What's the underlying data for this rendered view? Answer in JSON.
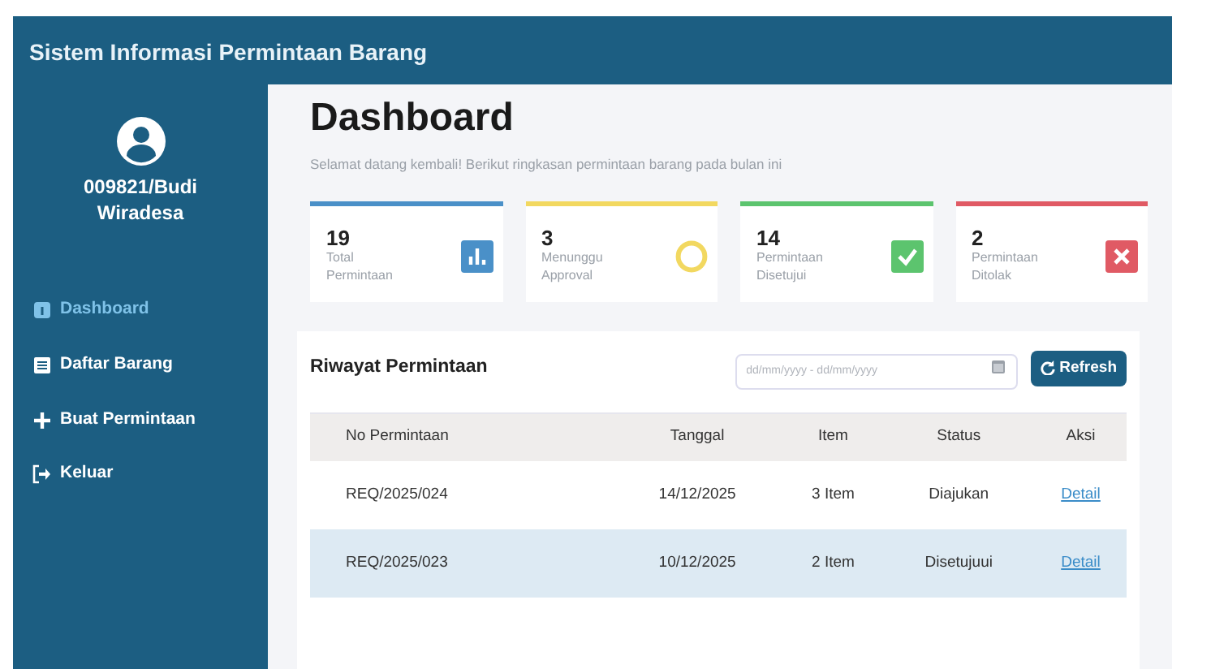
{
  "app_title": "Sistem Informasi Permintaan Barang",
  "user": {
    "name": "009821/Budi Wiradesa"
  },
  "sidebar": {
    "items": [
      {
        "label": "Dashboard",
        "kind": "gauge",
        "selected": true
      },
      {
        "label": "Daftar Barang",
        "kind": "list",
        "selected": false
      },
      {
        "label": "Buat Permintaan",
        "kind": "plus",
        "selected": false
      },
      {
        "label": "Keluar",
        "kind": "logout",
        "selected": false
      }
    ]
  },
  "page": {
    "title": "Dashboard",
    "subtitle": "Selamat datang kembali! Berikut ringkasan permintaan barang pada bulan ini"
  },
  "stats": [
    {
      "value": "19",
      "label": "Total Permintaan",
      "kind": "chart",
      "color": "#4a90c8"
    },
    {
      "value": "3",
      "label": "Menunggu Approval",
      "kind": "pending",
      "color": "#f2d860"
    },
    {
      "value": "14",
      "label": "Permintaan Disetujui",
      "kind": "check",
      "color": "#5cc46e"
    },
    {
      "value": "2",
      "label": "Permintaan Ditolak",
      "kind": "cross",
      "color": "#e05a64"
    }
  ],
  "history": {
    "title": "Riwayat Permintaan",
    "date_range": {
      "placeholder": "dd/mm/yyyy - dd/mm/yyyy"
    },
    "refresh_button": "Refresh",
    "columns": [
      "No Permintaan",
      "Tanggal",
      "Item",
      "Status",
      "Aksi"
    ],
    "rows": [
      {
        "cells": [
          "REQ/2025/024",
          "14/12/2025",
          "3 Item",
          "Diajukan"
        ],
        "action": "Detail",
        "selected": false
      },
      {
        "cells": [
          "REQ/2025/023",
          "10/12/2025",
          "2 Item",
          "Disetujuui"
        ],
        "action": "Detail",
        "selected": true
      }
    ]
  }
}
